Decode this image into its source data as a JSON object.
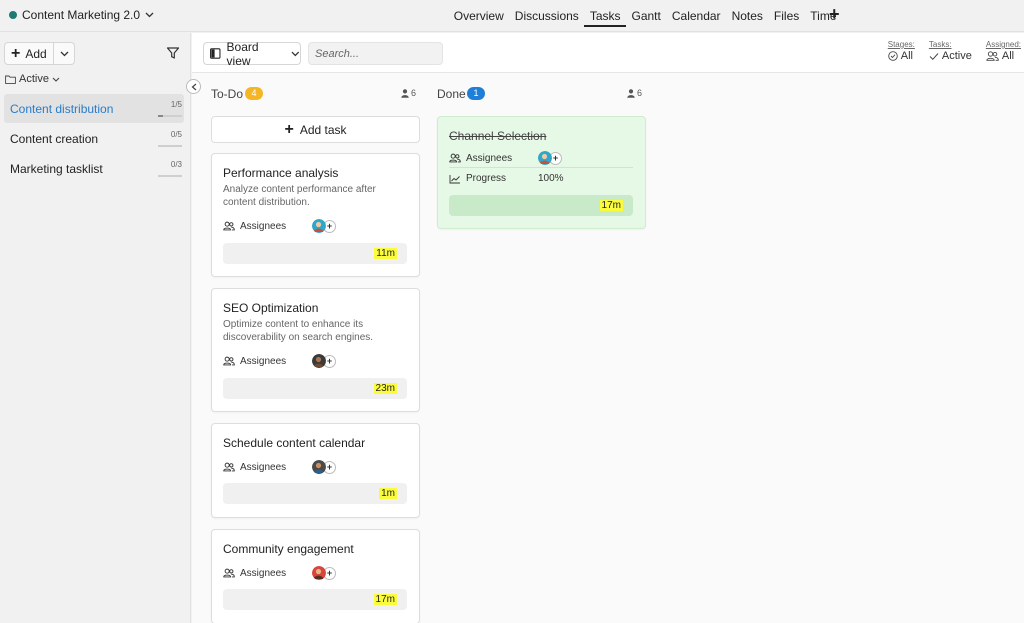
{
  "project": {
    "name": "Content Marketing 2.0",
    "color": "#1f7a73"
  },
  "nav": {
    "items": [
      "Overview",
      "Discussions",
      "Tasks",
      "Gantt",
      "Calendar",
      "Notes",
      "Files",
      "Time"
    ],
    "active": "Tasks"
  },
  "sidebar": {
    "add_label": "Add",
    "group_label": "Active",
    "tasklists": [
      {
        "name": "Content distribution",
        "count": "1/5",
        "progress": 0.2,
        "selected": true
      },
      {
        "name": "Content creation",
        "count": "0/5",
        "progress": 0,
        "selected": false
      },
      {
        "name": "Marketing tasklist",
        "count": "0/3",
        "progress": 0,
        "selected": false
      }
    ]
  },
  "toolbar": {
    "view_label": "Board view",
    "search_placeholder": "Search...",
    "filters": [
      {
        "label": "Stages:",
        "value": "All",
        "icon": "circle-check-icon"
      },
      {
        "label": "Tasks:",
        "value": "Active",
        "icon": "check-icon"
      },
      {
        "label": "Assigned:",
        "value": "All",
        "icon": "users-icon"
      }
    ]
  },
  "columns": {
    "todo": {
      "title": "To-Do",
      "count": "4",
      "badge_color": "#f5b625",
      "users": "6",
      "add_task_label": "Add task",
      "cards": [
        {
          "title": "Performance analysis",
          "description": "Analyze content performance after content distribution.",
          "assignees_label": "Assignees",
          "time": "11m"
        },
        {
          "title": "SEO Optimization",
          "description": "Optimize content to enhance its discoverability on search engines.",
          "assignees_label": "Assignees",
          "time": "23m"
        },
        {
          "title": "Schedule content calendar",
          "description": "",
          "assignees_label": "Assignees",
          "time": "1m"
        },
        {
          "title": "Community engagement",
          "description": "",
          "assignees_label": "Assignees",
          "time": "17m"
        }
      ]
    },
    "done": {
      "title": "Done",
      "count": "1",
      "badge_color": "#1f7ed8",
      "users": "6",
      "cards": [
        {
          "title": "Channel Selection",
          "assignees_label": "Assignees",
          "progress_label": "Progress",
          "progress_value": "100%",
          "time": "17m"
        }
      ]
    }
  }
}
